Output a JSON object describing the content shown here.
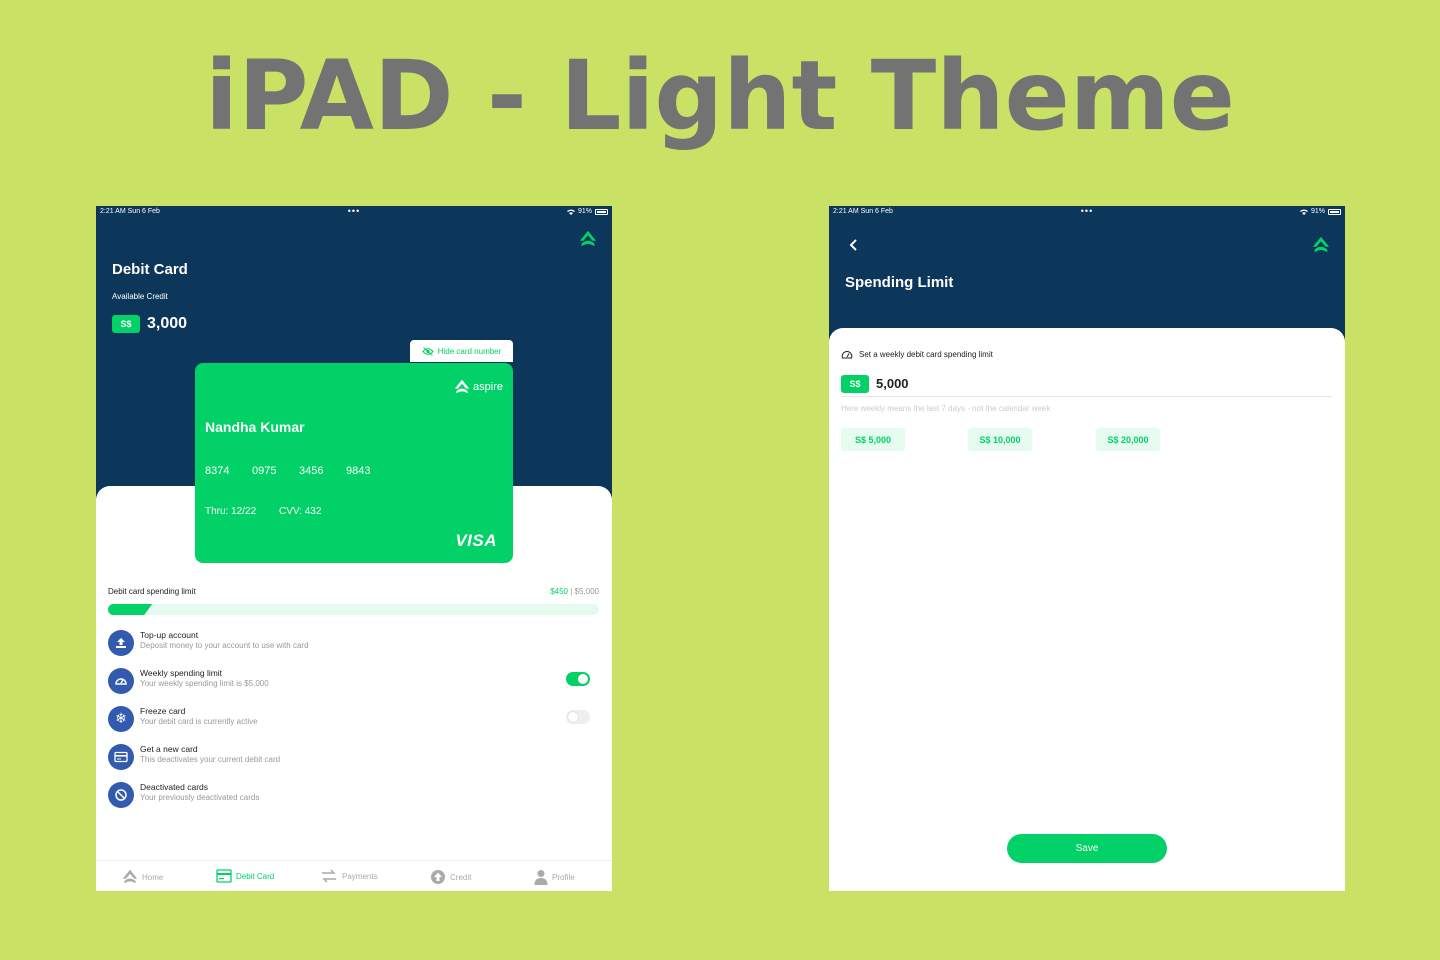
{
  "page_title": "iPAD - Light Theme",
  "status": {
    "time": "2:21 AM  Sun 6 Feb",
    "battery": "91%",
    "dots": "•••"
  },
  "left": {
    "title": "Debit Card",
    "available_label": "Available Credit",
    "currency": "S$",
    "amount": "3,000",
    "hide_label": "Hide card number",
    "card": {
      "brand": "aspire",
      "holder": "Nandha Kumar",
      "numbers": [
        "8374",
        "0975",
        "3456",
        "9843"
      ],
      "thru": "Thru: 12/22",
      "cvv": "CVV: 432",
      "network": "VISA"
    },
    "limit": {
      "label": "Debit card spending limit",
      "spent": "$450",
      "separator": " | ",
      "total": "$5,000",
      "progress": 0.09
    },
    "options": [
      {
        "title": "Top-up account",
        "subtitle": "Deposit money to your account to use with card",
        "icon": "upload-icon"
      },
      {
        "title": "Weekly spending limit",
        "subtitle": "Your weekly spending limit is $5,000",
        "icon": "speedometer-icon",
        "toggle": true
      },
      {
        "title": "Freeze card",
        "subtitle": "Your debit card is currently active",
        "icon": "snowflake-icon",
        "toggle": false
      },
      {
        "title": "Get a new card",
        "subtitle": "This deactivates your current debit card",
        "icon": "card-icon"
      },
      {
        "title": "Deactivated cards",
        "subtitle": "Your previously deactivated cards",
        "icon": "block-icon"
      }
    ],
    "tabs": [
      {
        "label": "Home",
        "icon": "home-logo-icon"
      },
      {
        "label": "Debit Card",
        "icon": "card-icon",
        "active": true
      },
      {
        "label": "Payments",
        "icon": "transfer-icon"
      },
      {
        "label": "Credit",
        "icon": "credit-up-icon"
      },
      {
        "label": "Profile",
        "icon": "person-icon"
      }
    ]
  },
  "right": {
    "title": "Spending Limit",
    "set_label": "Set a weekly debit card spending limit",
    "currency": "S$",
    "amount": "5,000",
    "note": "Here weekly means the last 7 days - not the calendar week",
    "chips": [
      "S$ 5,000",
      "S$ 10,000",
      "S$ 20,000"
    ],
    "save_label": "Save"
  },
  "colors": {
    "background": "#c9e265",
    "navy": "#0c365a",
    "green": "#01d167",
    "icon_blue": "#325baf",
    "title_grey": "#737373"
  }
}
